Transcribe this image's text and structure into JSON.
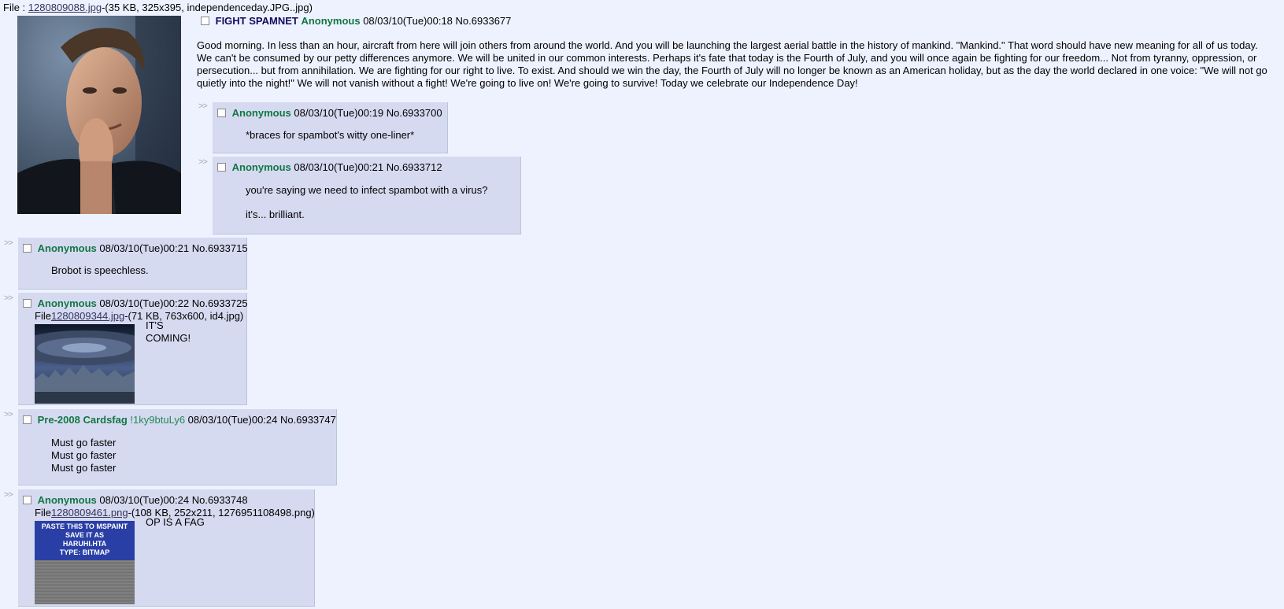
{
  "op": {
    "file_prefix": "File : ",
    "file_link": "1280809088.jpg",
    "file_meta": "-(35 KB, 325x395, independenceday.JPG..jpg)",
    "subject": "FIGHT SPAMNET",
    "name": "Anonymous",
    "datetime": "08/03/10(Tue)00:18",
    "number": "No.6933677",
    "comment": "Good morning. In less than an hour, aircraft from here will join others from around the world. And you will be launching the largest aerial battle in the history of mankind. \"Mankind.\" That word should have new meaning for all of us today. We can't be consumed by our petty differences anymore. We will be united in our common interests. Perhaps it's fate that today is the Fourth of July, and you will once again be fighting for our freedom... Not from tyranny, oppression, or persecution... but from annihilation. We are fighting for our right to live. To exist. And should we win the day, the Fourth of July will no longer be known as an American holiday, but as the day the world declared in one voice: \"We will not go quietly into the night!\" We will not vanish without a fight! We're going to live on! We're going to survive! Today we celebrate our Independence Day!"
  },
  "reply_marker": ">>",
  "file_label": "File",
  "replies": [
    {
      "name": "Anonymous",
      "datetime": "08/03/10(Tue)00:19",
      "number": "No.6933700",
      "lines": [
        "*braces for spambot's witty one-liner*"
      ]
    },
    {
      "name": "Anonymous",
      "datetime": "08/03/10(Tue)00:21",
      "number": "No.6933712",
      "lines": [
        "you're saying we need to infect spambot with a virus?",
        "it's... brilliant."
      ]
    },
    {
      "name": "Anonymous",
      "datetime": "08/03/10(Tue)00:21",
      "number": "No.6933715",
      "lines": [
        "Brobot is speechless."
      ]
    },
    {
      "name": "Anonymous",
      "datetime": "08/03/10(Tue)00:22",
      "number": "No.6933725",
      "file_link": "1280809344.jpg",
      "file_meta": "-(71 KB, 763x600, id4.jpg)",
      "lines": [
        "IT'S",
        "COMING!"
      ]
    },
    {
      "name": "Pre-2008 Cardsfag",
      "tripcode": "!1ky9btuLy6",
      "datetime": "08/03/10(Tue)00:24",
      "number": "No.6933747",
      "lines": [
        "Must go faster",
        "Must go faster",
        "Must go faster"
      ]
    },
    {
      "name": "Anonymous",
      "datetime": "08/03/10(Tue)00:24",
      "number": "No.6933748",
      "file_link": "1280809461.png",
      "file_meta": "-(108 KB, 252x211, 1276951108498.png)",
      "image_text": [
        "PASTE THIS TO MSPAINT",
        "SAVE IT AS",
        "HARUHI.HTA",
        "TYPE: BITMAP"
      ],
      "lines": [
        "OP IS A FAG"
      ]
    }
  ],
  "colors": {
    "background": "#eef2ff",
    "reply_background": "#d6daf0",
    "name": "#117743",
    "subject": "#0f0c5d",
    "link": "#34345c"
  }
}
